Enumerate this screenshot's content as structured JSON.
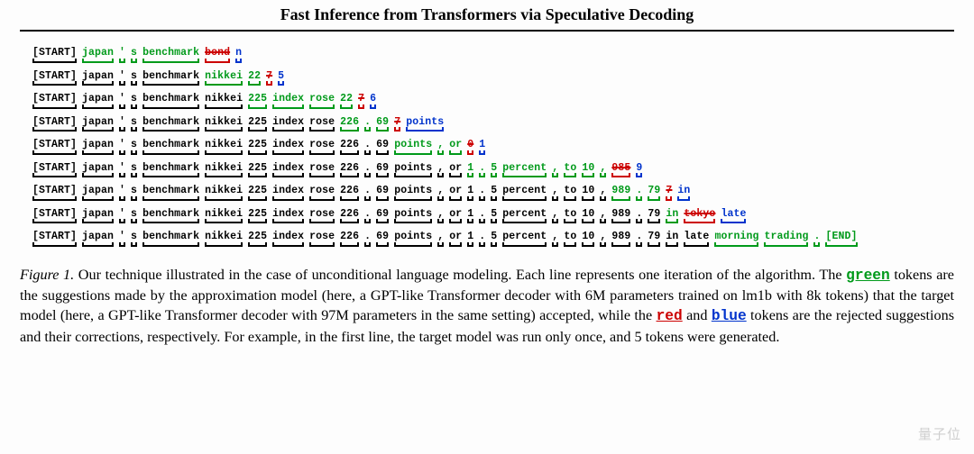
{
  "title": "Fast Inference from Transformers via Speculative Decoding",
  "colors": {
    "green": "#009a1a",
    "red": "#cc0000",
    "blue": "#0033cc",
    "black": "#000"
  },
  "lines": [
    [
      {
        "t": "[START]",
        "c": "blk"
      },
      {
        "t": "japan",
        "c": "grn"
      },
      {
        "t": "'",
        "c": "grn"
      },
      {
        "t": "s",
        "c": "grn"
      },
      {
        "t": "benchmark",
        "c": "grn"
      },
      {
        "t": "bond",
        "c": "red",
        "s": true
      },
      {
        "t": "n",
        "c": "blu"
      }
    ],
    [
      {
        "t": "[START]",
        "c": "blk"
      },
      {
        "t": "japan",
        "c": "blk"
      },
      {
        "t": "'",
        "c": "blk"
      },
      {
        "t": "s",
        "c": "blk"
      },
      {
        "t": "benchmark",
        "c": "blk"
      },
      {
        "t": "nikkei",
        "c": "grn"
      },
      {
        "t": "22",
        "c": "grn"
      },
      {
        "t": "7",
        "c": "red",
        "s": true
      },
      {
        "t": "5",
        "c": "blu"
      }
    ],
    [
      {
        "t": "[START]",
        "c": "blk"
      },
      {
        "t": "japan",
        "c": "blk"
      },
      {
        "t": "'",
        "c": "blk"
      },
      {
        "t": "s",
        "c": "blk"
      },
      {
        "t": "benchmark",
        "c": "blk"
      },
      {
        "t": "nikkei",
        "c": "blk"
      },
      {
        "t": "225",
        "c": "grn"
      },
      {
        "t": "index",
        "c": "grn"
      },
      {
        "t": "rose",
        "c": "grn"
      },
      {
        "t": "22",
        "c": "grn"
      },
      {
        "t": "7",
        "c": "red",
        "s": true
      },
      {
        "t": "6",
        "c": "blu"
      }
    ],
    [
      {
        "t": "[START]",
        "c": "blk"
      },
      {
        "t": "japan",
        "c": "blk"
      },
      {
        "t": "'",
        "c": "blk"
      },
      {
        "t": "s",
        "c": "blk"
      },
      {
        "t": "benchmark",
        "c": "blk"
      },
      {
        "t": "nikkei",
        "c": "blk"
      },
      {
        "t": "225",
        "c": "blk"
      },
      {
        "t": "index",
        "c": "blk"
      },
      {
        "t": "rose",
        "c": "blk"
      },
      {
        "t": "226",
        "c": "grn"
      },
      {
        "t": ".",
        "c": "grn"
      },
      {
        "t": "69",
        "c": "grn"
      },
      {
        "t": "7",
        "c": "red",
        "s": true
      },
      {
        "t": "points",
        "c": "blu"
      }
    ],
    [
      {
        "t": "[START]",
        "c": "blk"
      },
      {
        "t": "japan",
        "c": "blk"
      },
      {
        "t": "'",
        "c": "blk"
      },
      {
        "t": "s",
        "c": "blk"
      },
      {
        "t": "benchmark",
        "c": "blk"
      },
      {
        "t": "nikkei",
        "c": "blk"
      },
      {
        "t": "225",
        "c": "blk"
      },
      {
        "t": "index",
        "c": "blk"
      },
      {
        "t": "rose",
        "c": "blk"
      },
      {
        "t": "226",
        "c": "blk"
      },
      {
        "t": ".",
        "c": "blk"
      },
      {
        "t": "69",
        "c": "blk"
      },
      {
        "t": "points",
        "c": "grn"
      },
      {
        "t": ",",
        "c": "grn"
      },
      {
        "t": "or",
        "c": "grn"
      },
      {
        "t": "0",
        "c": "red",
        "s": true
      },
      {
        "t": "1",
        "c": "blu"
      }
    ],
    [
      {
        "t": "[START]",
        "c": "blk"
      },
      {
        "t": "japan",
        "c": "blk"
      },
      {
        "t": "'",
        "c": "blk"
      },
      {
        "t": "s",
        "c": "blk"
      },
      {
        "t": "benchmark",
        "c": "blk"
      },
      {
        "t": "nikkei",
        "c": "blk"
      },
      {
        "t": "225",
        "c": "blk"
      },
      {
        "t": "index",
        "c": "blk"
      },
      {
        "t": "rose",
        "c": "blk"
      },
      {
        "t": "226",
        "c": "blk"
      },
      {
        "t": ".",
        "c": "blk"
      },
      {
        "t": "69",
        "c": "blk"
      },
      {
        "t": "points",
        "c": "blk"
      },
      {
        "t": ",",
        "c": "blk"
      },
      {
        "t": "or",
        "c": "blk"
      },
      {
        "t": "1",
        "c": "grn"
      },
      {
        "t": ".",
        "c": "grn"
      },
      {
        "t": "5",
        "c": "grn"
      },
      {
        "t": "percent",
        "c": "grn"
      },
      {
        "t": ",",
        "c": "grn"
      },
      {
        "t": "to",
        "c": "grn"
      },
      {
        "t": "10",
        "c": "grn"
      },
      {
        "t": ",",
        "c": "grn"
      },
      {
        "t": "985",
        "c": "red",
        "s": true
      },
      {
        "t": "9",
        "c": "blu"
      }
    ],
    [
      {
        "t": "[START]",
        "c": "blk"
      },
      {
        "t": "japan",
        "c": "blk"
      },
      {
        "t": "'",
        "c": "blk"
      },
      {
        "t": "s",
        "c": "blk"
      },
      {
        "t": "benchmark",
        "c": "blk"
      },
      {
        "t": "nikkei",
        "c": "blk"
      },
      {
        "t": "225",
        "c": "blk"
      },
      {
        "t": "index",
        "c": "blk"
      },
      {
        "t": "rose",
        "c": "blk"
      },
      {
        "t": "226",
        "c": "blk"
      },
      {
        "t": ".",
        "c": "blk"
      },
      {
        "t": "69",
        "c": "blk"
      },
      {
        "t": "points",
        "c": "blk"
      },
      {
        "t": ",",
        "c": "blk"
      },
      {
        "t": "or",
        "c": "blk"
      },
      {
        "t": "1",
        "c": "blk"
      },
      {
        "t": ".",
        "c": "blk"
      },
      {
        "t": "5",
        "c": "blk"
      },
      {
        "t": "percent",
        "c": "blk"
      },
      {
        "t": ",",
        "c": "blk"
      },
      {
        "t": "to",
        "c": "blk"
      },
      {
        "t": "10",
        "c": "blk"
      },
      {
        "t": ",",
        "c": "blk"
      },
      {
        "t": "989",
        "c": "grn"
      },
      {
        "t": ".",
        "c": "grn"
      },
      {
        "t": "79",
        "c": "grn"
      },
      {
        "t": "7",
        "c": "red",
        "s": true
      },
      {
        "t": "in",
        "c": "blu"
      }
    ],
    [
      {
        "t": "[START]",
        "c": "blk"
      },
      {
        "t": "japan",
        "c": "blk"
      },
      {
        "t": "'",
        "c": "blk"
      },
      {
        "t": "s",
        "c": "blk"
      },
      {
        "t": "benchmark",
        "c": "blk"
      },
      {
        "t": "nikkei",
        "c": "blk"
      },
      {
        "t": "225",
        "c": "blk"
      },
      {
        "t": "index",
        "c": "blk"
      },
      {
        "t": "rose",
        "c": "blk"
      },
      {
        "t": "226",
        "c": "blk"
      },
      {
        "t": ".",
        "c": "blk"
      },
      {
        "t": "69",
        "c": "blk"
      },
      {
        "t": "points",
        "c": "blk"
      },
      {
        "t": ",",
        "c": "blk"
      },
      {
        "t": "or",
        "c": "blk"
      },
      {
        "t": "1",
        "c": "blk"
      },
      {
        "t": ".",
        "c": "blk"
      },
      {
        "t": "5",
        "c": "blk"
      },
      {
        "t": "percent",
        "c": "blk"
      },
      {
        "t": ",",
        "c": "blk"
      },
      {
        "t": "to",
        "c": "blk"
      },
      {
        "t": "10",
        "c": "blk"
      },
      {
        "t": ",",
        "c": "blk"
      },
      {
        "t": "989",
        "c": "blk"
      },
      {
        "t": ".",
        "c": "blk"
      },
      {
        "t": "79",
        "c": "blk"
      },
      {
        "t": "in",
        "c": "grn"
      },
      {
        "t": "tokyo",
        "c": "red",
        "s": true
      },
      {
        "t": "late",
        "c": "blu"
      }
    ],
    [
      {
        "t": "[START]",
        "c": "blk"
      },
      {
        "t": "japan",
        "c": "blk"
      },
      {
        "t": "'",
        "c": "blk"
      },
      {
        "t": "s",
        "c": "blk"
      },
      {
        "t": "benchmark",
        "c": "blk"
      },
      {
        "t": "nikkei",
        "c": "blk"
      },
      {
        "t": "225",
        "c": "blk"
      },
      {
        "t": "index",
        "c": "blk"
      },
      {
        "t": "rose",
        "c": "blk"
      },
      {
        "t": "226",
        "c": "blk"
      },
      {
        "t": ".",
        "c": "blk"
      },
      {
        "t": "69",
        "c": "blk"
      },
      {
        "t": "points",
        "c": "blk"
      },
      {
        "t": ",",
        "c": "blk"
      },
      {
        "t": "or",
        "c": "blk"
      },
      {
        "t": "1",
        "c": "blk"
      },
      {
        "t": ".",
        "c": "blk"
      },
      {
        "t": "5",
        "c": "blk"
      },
      {
        "t": "percent",
        "c": "blk"
      },
      {
        "t": ",",
        "c": "blk"
      },
      {
        "t": "to",
        "c": "blk"
      },
      {
        "t": "10",
        "c": "blk"
      },
      {
        "t": ",",
        "c": "blk"
      },
      {
        "t": "989",
        "c": "blk"
      },
      {
        "t": ".",
        "c": "blk"
      },
      {
        "t": "79",
        "c": "blk"
      },
      {
        "t": "in",
        "c": "blk"
      },
      {
        "t": "late",
        "c": "blk"
      },
      {
        "t": "morning",
        "c": "grn"
      },
      {
        "t": "trading",
        "c": "grn"
      },
      {
        "t": ".",
        "c": "grn"
      },
      {
        "t": "[END]",
        "c": "grn"
      }
    ]
  ],
  "caption": {
    "prefix": "Figure 1.",
    "p1": " Our technique illustrated in the case of unconditional language modeling. Each line represents one iteration of the algorithm. The ",
    "green": "green",
    "p2": " tokens are the suggestions made by the approximation model (here, a GPT-like Transformer decoder with 6M parameters trained on lm1b with 8k tokens) that the target model (here, a GPT-like Transformer decoder with 97M parameters in the same setting) accepted, while the ",
    "red": "red",
    "p3": " and ",
    "blue": "blue",
    "p4": " tokens are the rejected suggestions and their corrections, respectively. For example, in the first line, the target model was run only once, and 5 tokens were generated."
  },
  "watermark": "量子位"
}
